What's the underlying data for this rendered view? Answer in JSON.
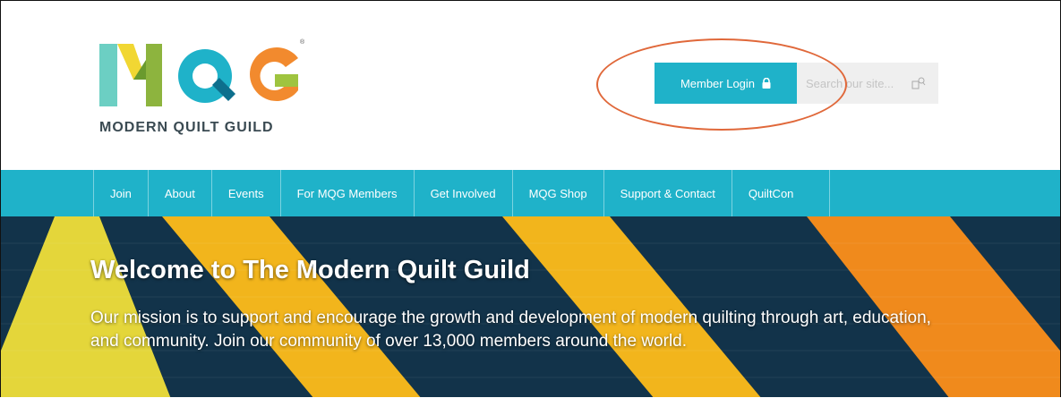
{
  "brand": {
    "logo_letters": "MQG",
    "name": "MODERN QUILT GUILD",
    "colors": {
      "m_teal": "#6ccfc3",
      "m_yellow": "#f1d733",
      "m_green": "#8db43e",
      "q_blue": "#1fb2c9",
      "g_orange": "#f28a2e",
      "g_green": "#9fc43f"
    }
  },
  "header": {
    "login_label": "Member Login",
    "login_icon": "lock-icon",
    "search_placeholder": "Search our site...",
    "search_icon": "search-icon"
  },
  "nav": {
    "items": [
      {
        "label": "Join"
      },
      {
        "label": "About"
      },
      {
        "label": "Events"
      },
      {
        "label": "For MQG Members"
      },
      {
        "label": "Get Involved"
      },
      {
        "label": "MQG Shop"
      },
      {
        "label": "Support & Contact"
      },
      {
        "label": "QuiltCon"
      }
    ]
  },
  "hero": {
    "title": "Welcome to The Modern Quilt Guild",
    "text": "Our mission is to support and encourage the growth and development of modern quilting through art, education, and community. Join our community of over 13,000 members around the world."
  },
  "theme": {
    "accent": "#1fb2c9",
    "annotation": "#e0683a",
    "hero_navy": "#12334a",
    "hero_yellow": "#f2b51c",
    "hero_orange": "#f08a1c",
    "hero_lime": "#e4d63a"
  }
}
